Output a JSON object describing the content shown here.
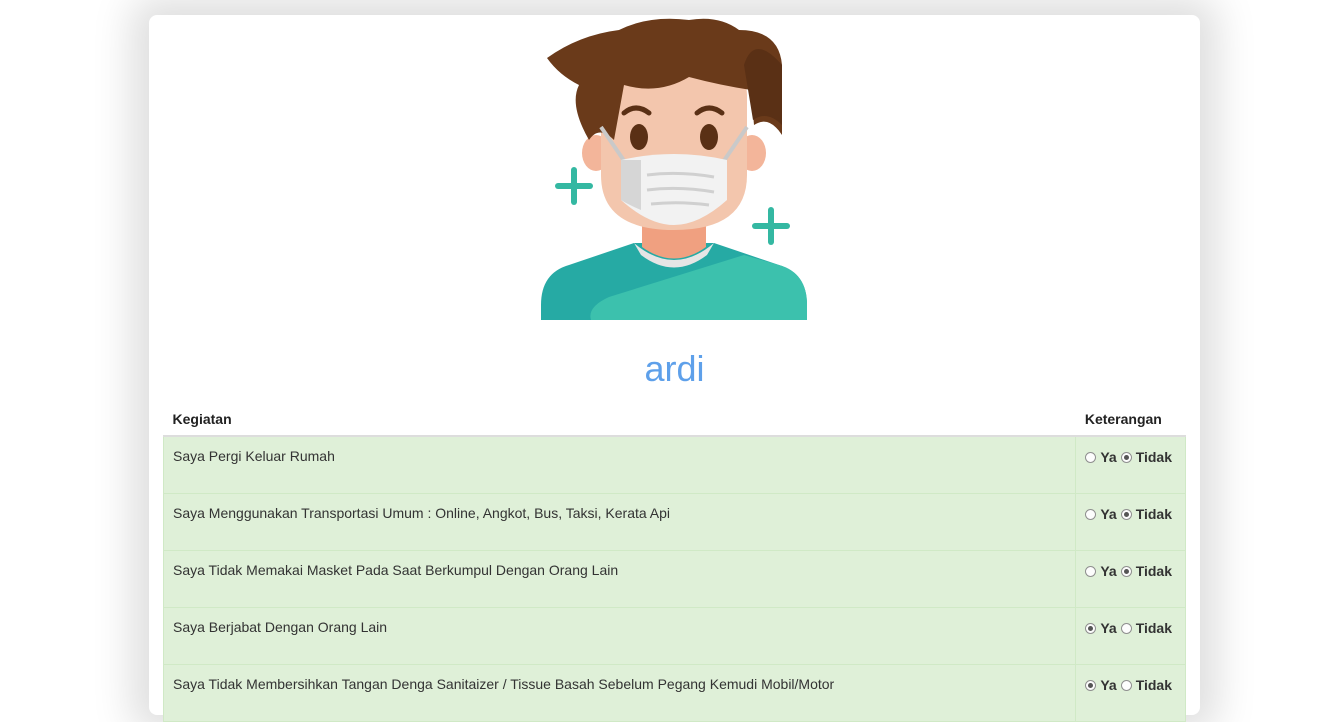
{
  "profile": {
    "name": "ardi"
  },
  "table": {
    "headers": [
      "Kegiatan",
      "Keterangan"
    ],
    "option_yes": "Ya",
    "option_no": "Tidak",
    "rows": [
      {
        "activity": "Saya Pergi Keluar Rumah",
        "answer": "Tidak"
      },
      {
        "activity": "Saya Menggunakan Transportasi Umum : Online, Angkot, Bus, Taksi, Kerata Api",
        "answer": "Tidak"
      },
      {
        "activity": "Saya Tidak Memakai Masket Pada Saat Berkumpul Dengan Orang Lain",
        "answer": "Tidak"
      },
      {
        "activity": "Saya Berjabat Dengan Orang Lain",
        "answer": "Ya"
      },
      {
        "activity": "Saya Tidak Membersihkan Tangan Denga Sanitaizer / Tissue Basah Sebelum Pegang Kemudi Mobil/Motor",
        "answer": "Ya"
      }
    ]
  },
  "colors": {
    "name_text": "#5ea0ea",
    "row_background": "#dff0d8"
  }
}
